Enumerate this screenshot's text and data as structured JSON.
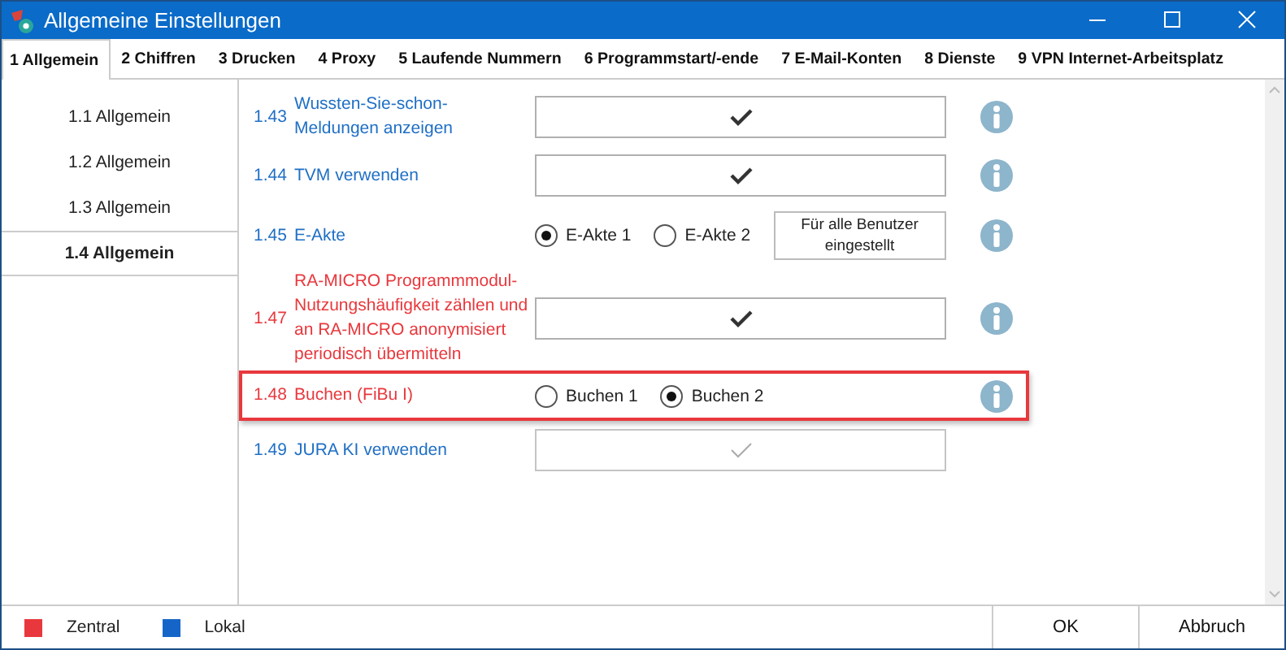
{
  "window": {
    "title": "Allgemeine Einstellungen"
  },
  "tabs": [
    {
      "label": "1 Allgemein",
      "selected": true
    },
    {
      "label": "2 Chiffren",
      "selected": false
    },
    {
      "label": "3 Drucken",
      "selected": false
    },
    {
      "label": "4 Proxy",
      "selected": false
    },
    {
      "label": "5 Laufende Nummern",
      "selected": false
    },
    {
      "label": "6 Programmstart/-ende",
      "selected": false
    },
    {
      "label": "7 E-Mail-Konten",
      "selected": false
    },
    {
      "label": "8 Dienste",
      "selected": false
    },
    {
      "label": "9 VPN Internet-Arbeitsplatz",
      "selected": false
    }
  ],
  "sidebar": {
    "items": [
      {
        "label": "1.1 Allgemein",
        "selected": false
      },
      {
        "label": "1.2 Allgemein",
        "selected": false
      },
      {
        "label": "1.3 Allgemein",
        "selected": false
      },
      {
        "label": "1.4 Allgemein",
        "selected": true
      }
    ]
  },
  "settings": [
    {
      "number": "1.43",
      "label": "Wussten-Sie-schon-Meldungen anzeigen",
      "color": "#1f6fc5",
      "kind": "checkbox",
      "checked": true,
      "disabled": false,
      "info": true,
      "highlighted": false
    },
    {
      "number": "1.44",
      "label": "TVM verwenden",
      "color": "#1f6fc5",
      "kind": "checkbox",
      "checked": true,
      "disabled": false,
      "info": true,
      "highlighted": false
    },
    {
      "number": "1.45",
      "label": "E-Akte",
      "color": "#1f6fc5",
      "kind": "radio",
      "options": [
        {
          "label": "E-Akte 1",
          "selected": true
        },
        {
          "label": "E-Akte 2",
          "selected": false
        }
      ],
      "button": "Für alle Benutzer eingestellt",
      "info": true,
      "highlighted": false
    },
    {
      "number": "1.47",
      "label": "RA-MICRO Programmmodul-Nutzungshäufigkeit zählen und an RA-MICRO anonymisiert periodisch übermitteln",
      "color": "#e8383d",
      "kind": "checkbox",
      "checked": true,
      "disabled": false,
      "info": true,
      "highlighted": false
    },
    {
      "number": "1.48",
      "label": "Buchen (FiBu I)",
      "color": "#e8383d",
      "kind": "radio",
      "options": [
        {
          "label": "Buchen 1",
          "selected": false
        },
        {
          "label": "Buchen 2",
          "selected": true
        }
      ],
      "info": true,
      "highlighted": true
    },
    {
      "number": "1.49",
      "label": "JURA KI verwenden",
      "color": "#1f6fc5",
      "kind": "checkbox",
      "checked": true,
      "disabled": true,
      "info": false,
      "highlighted": false
    }
  ],
  "legend": [
    {
      "label": "Zentral",
      "color": "#e8383d"
    },
    {
      "label": "Lokal",
      "color": "#1565c8"
    }
  ],
  "buttons": [
    "OK",
    "Abbruch"
  ]
}
